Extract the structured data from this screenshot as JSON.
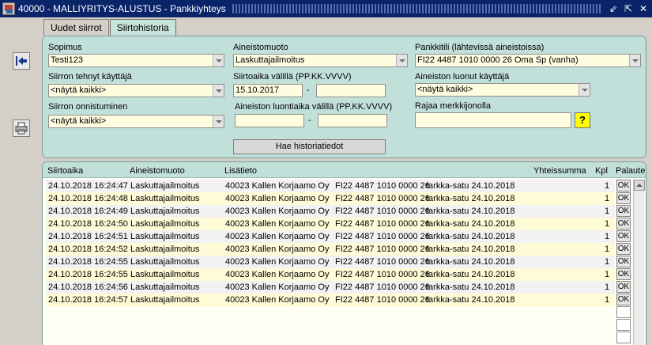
{
  "window": {
    "title": "40000 - MALLIYRITYS-ALUSTUS - Pankkiyhteys",
    "minimize_glyph": "⇙",
    "restore_glyph": "⇱",
    "close_glyph": "✕"
  },
  "tabs": [
    {
      "label": "Uudet siirrot",
      "active": false
    },
    {
      "label": "Siirtohistoria",
      "active": true
    }
  ],
  "side_icons": [
    "exit-arrow-icon",
    "printer-icon"
  ],
  "filters": {
    "sopimus": {
      "label": "Sopimus",
      "value": "Testi123"
    },
    "aineistomuoto": {
      "label": "Aineistomuoto",
      "value": "Laskuttajailmoitus"
    },
    "pankkitili": {
      "label": "Pankkitili (lähtevissä aineistoissa)",
      "value": "FI22 4487 1010 0000 26 Oma Sp (vanha)"
    },
    "siirron_tehnyt": {
      "label": "Siirron tehnyt käyttäjä",
      "value": "<näytä kaikki>"
    },
    "siirtoaika": {
      "label": "Siirtoaika välillä (PP.KK.VVVV)",
      "from": "15.10.2017",
      "to": "",
      "separator": "-"
    },
    "aineiston_luonut": {
      "label": "Aineiston luonut käyttäjä",
      "value": "<näytä kaikki>"
    },
    "siirron_onnistuminen": {
      "label": "Siirron onnistuminen",
      "value": "<näytä kaikki>"
    },
    "luontiaika": {
      "label": "Aineiston luontiaika välillä (PP.KK.VVVV)",
      "from": "",
      "to": "",
      "separator": "-"
    },
    "rajaa": {
      "label": "Rajaa merkkijonolla",
      "value": "",
      "help": "?"
    }
  },
  "fetch_button": "Hae historiatiedot",
  "results": {
    "columns": [
      "Siirtoaika",
      "Aineistomuoto",
      "Lisätieto",
      "Yhteissumma",
      "Kpl",
      "Palaute"
    ],
    "ok_label": "OK",
    "rows": [
      {
        "time": "24.10.2018 16:24:47",
        "format": "Laskuttajailmoitus",
        "company": "40023 Kallen Korjaamo Oy",
        "account": "FI22 4487 1010 0000 26",
        "info": "tarkka-satu 24.10.2018",
        "kpl": "1"
      },
      {
        "time": "24.10.2018 16:24:48",
        "format": "Laskuttajailmoitus",
        "company": "40023 Kallen Korjaamo Oy",
        "account": "FI22 4487 1010 0000 26",
        "info": "tarkka-satu 24.10.2018",
        "kpl": "1"
      },
      {
        "time": "24.10.2018 16:24:49",
        "format": "Laskuttajailmoitus",
        "company": "40023 Kallen Korjaamo Oy",
        "account": "FI22 4487 1010 0000 26",
        "info": "tarkka-satu 24.10.2018",
        "kpl": "1"
      },
      {
        "time": "24.10.2018 16:24:50",
        "format": "Laskuttajailmoitus",
        "company": "40023 Kallen Korjaamo Oy",
        "account": "FI22 4487 1010 0000 26",
        "info": "tarkka-satu 24.10.2018",
        "kpl": "1"
      },
      {
        "time": "24.10.2018 16:24:51",
        "format": "Laskuttajailmoitus",
        "company": "40023 Kallen Korjaamo Oy",
        "account": "FI22 4487 1010 0000 26",
        "info": "tarkka-satu 24.10.2018",
        "kpl": "1"
      },
      {
        "time": "24.10.2018 16:24:52",
        "format": "Laskuttajailmoitus",
        "company": "40023 Kallen Korjaamo Oy",
        "account": "FI22 4487 1010 0000 26",
        "info": "tarkka-satu 24.10.2018",
        "kpl": "1"
      },
      {
        "time": "24.10.2018 16:24:55",
        "format": "Laskuttajailmoitus",
        "company": "40023 Kallen Korjaamo Oy",
        "account": "FI22 4487 1010 0000 26",
        "info": "tarkka-satu 24.10.2018",
        "kpl": "1"
      },
      {
        "time": "24.10.2018 16:24:55",
        "format": "Laskuttajailmoitus",
        "company": "40023 Kallen Korjaamo Oy",
        "account": "FI22 4487 1010 0000 26",
        "info": "tarkka-satu 24.10.2018",
        "kpl": "1"
      },
      {
        "time": "24.10.2018 16:24:56",
        "format": "Laskuttajailmoitus",
        "company": "40023 Kallen Korjaamo Oy",
        "account": "FI22 4487 1010 0000 26",
        "info": "tarkka-satu 24.10.2018",
        "kpl": "1"
      },
      {
        "time": "24.10.2018 16:24:57",
        "format": "Laskuttajailmoitus",
        "company": "40023 Kallen Korjaamo Oy",
        "account": "FI22 4487 1010 0000 26",
        "info": "tarkka-satu 24.10.2018",
        "kpl": "1"
      }
    ]
  },
  "colors": {
    "titlebar": "#0a246a",
    "panel": "#c2e0da",
    "field": "#fffde0",
    "row_alt": "#fffbd6",
    "help_button": "#ffff00"
  }
}
